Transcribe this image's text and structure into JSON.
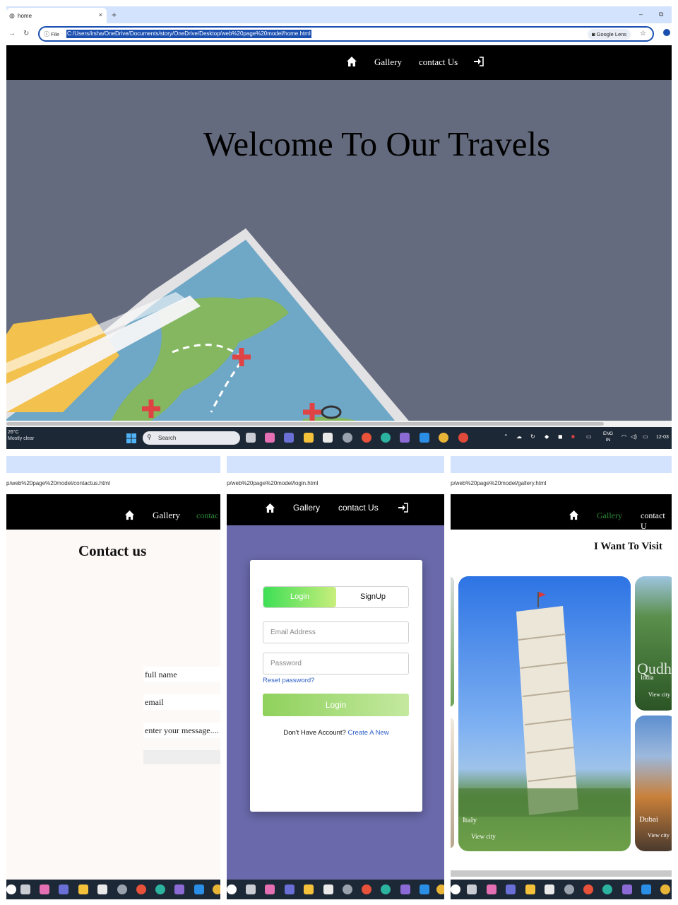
{
  "browser": {
    "tab_title": "home",
    "new_tab": "+",
    "tab_close": "×",
    "minimize": "–",
    "restore": "⧉",
    "file_chip": "File",
    "url": "C:/Users/irsha/OneDrive/Documents/story/OneDrive/Desktop/web%20page%20model/home.html",
    "lens_label": "Google Lens"
  },
  "site_nav": {
    "gallery": "Gallery",
    "contact": "contact Us"
  },
  "hero": {
    "title": "Welcome To Our Travels"
  },
  "taskbar": {
    "temperature": "26°C",
    "weather": "Mostly clear",
    "search_placeholder": "Search",
    "lang_line1": "ENG",
    "lang_line2": "IN",
    "time": "12-03"
  },
  "contact_page": {
    "url": "p/web%20page%20model/contactus.html",
    "nav_gallery": "Gallery",
    "nav_contact": "contac",
    "title": "Contact us",
    "name_placeholder": "full name",
    "email_placeholder": "email",
    "message_placeholder": "enter your message...."
  },
  "login_page": {
    "url": "p/web%20page%20model/login.html",
    "nav_gallery": "Gallery",
    "nav_contact": "contact Us",
    "tab_login": "Login",
    "tab_signup": "SignUp",
    "email_placeholder": "Email Address",
    "password_placeholder": "Password",
    "reset_link": "Reset password?",
    "login_button": "Login",
    "no_account": "Don't Have Account?",
    "create_link": "Create A New"
  },
  "gallery_page": {
    "url": "p/web%20page%20model/gallery.html",
    "nav_gallery": "Gallery",
    "nav_contact": "contact U",
    "title": "I Want To Visit",
    "cards": [
      {
        "name": "Italy",
        "action": "View city"
      },
      {
        "name": "India",
        "action": "View city"
      },
      {
        "name": "Dubai",
        "action": "View city"
      }
    ],
    "india_overlay": "Qudh"
  },
  "colors": {
    "nav_active_green": "#2f8f3a",
    "hero_bg": "#646b7e",
    "login_bg": "#6a69ab",
    "link_blue": "#2d5fc7"
  }
}
